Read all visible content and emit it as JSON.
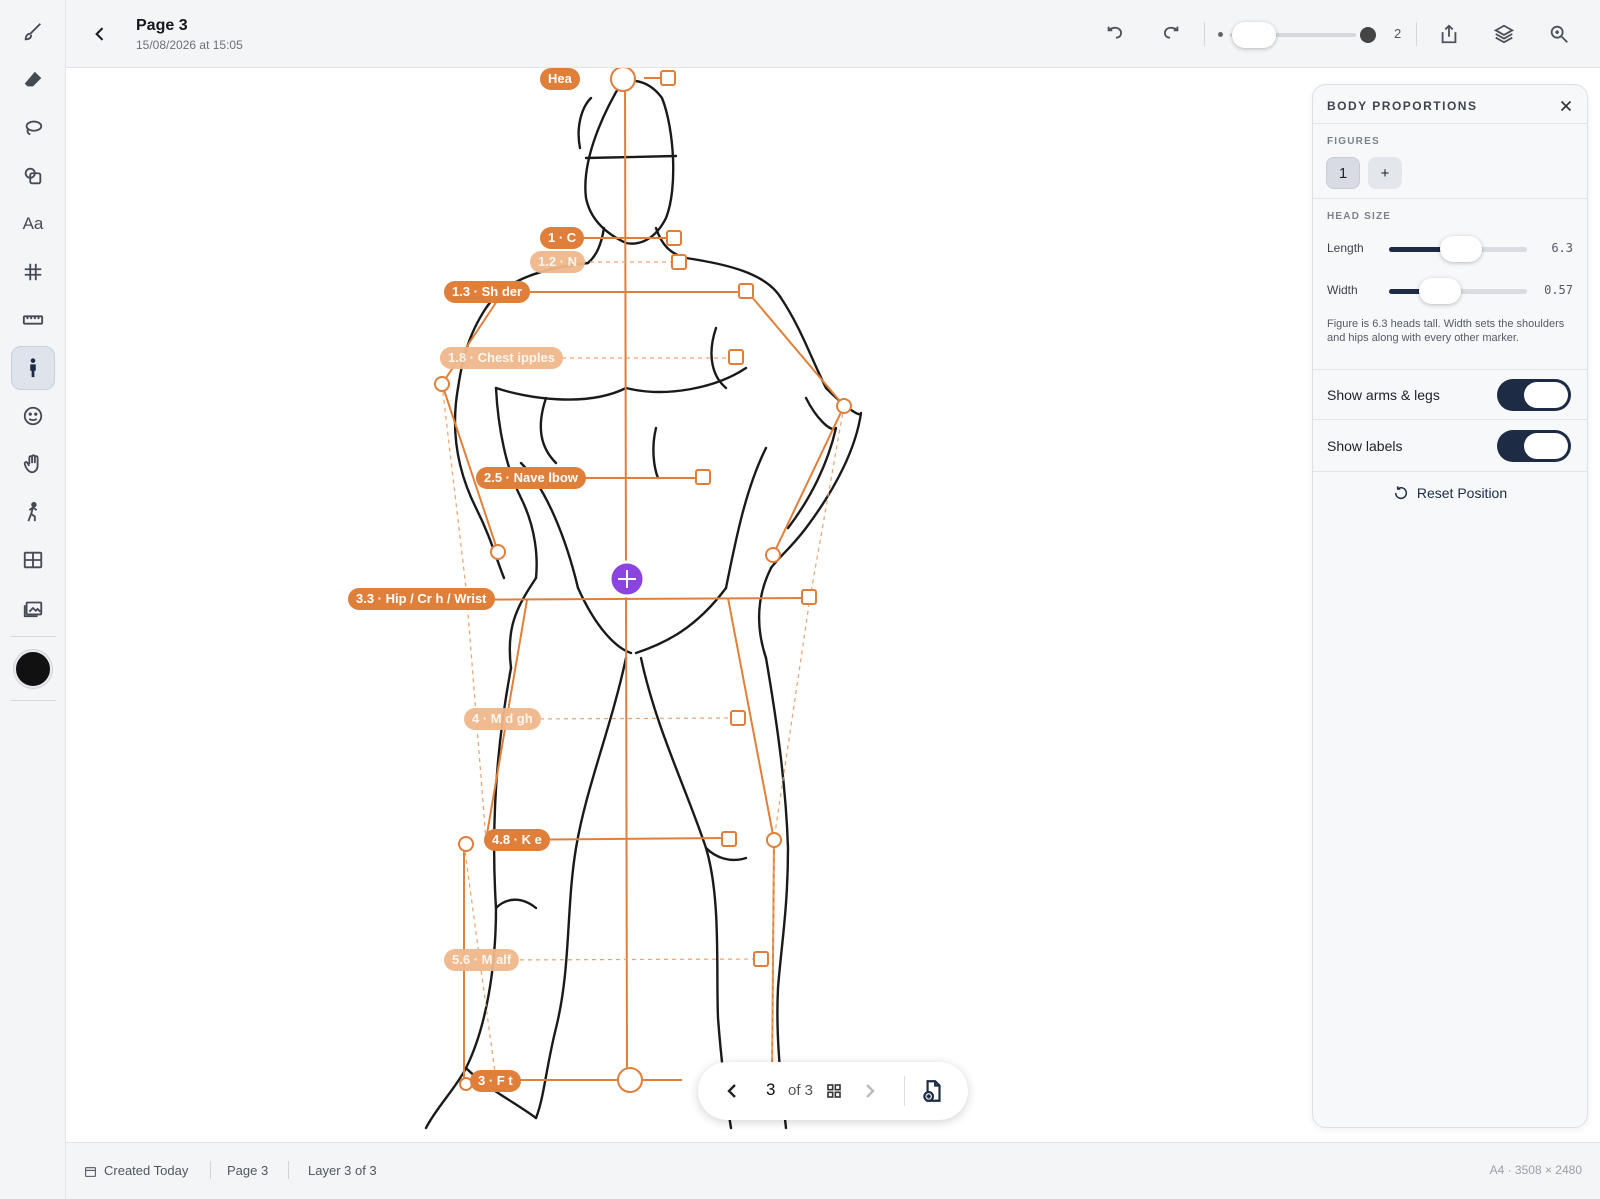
{
  "header": {
    "title": "Page 3",
    "date": "15/08/2026 at 15:05",
    "brush_size_value": "2"
  },
  "tools": [
    {
      "name": "brush-icon"
    },
    {
      "name": "eraser-icon"
    },
    {
      "name": "lasso-icon"
    },
    {
      "name": "shapes-icon"
    },
    {
      "name": "text-icon",
      "label": "Aa"
    },
    {
      "name": "grid-icon"
    },
    {
      "name": "ruler-icon"
    },
    {
      "name": "body-proportions-icon",
      "active": true
    },
    {
      "name": "face-icon"
    },
    {
      "name": "hand-icon"
    },
    {
      "name": "pose-icon"
    },
    {
      "name": "panels-icon"
    },
    {
      "name": "image-icon"
    }
  ],
  "current_color": "#111111",
  "accent_color": "#e07f3a",
  "labels": {
    "head": "Hea",
    "chin": "1 · C",
    "neck": "1.2 · N",
    "shoulder": "1.3 · Sh  der",
    "chest": "1.8 · Chest  ipples",
    "navel": "2.5 · Nave  lbow",
    "hip": "3.3 · Hip / Cr   h / Wrist",
    "midthigh": "4 · M  d  gh",
    "knee": "4.8 · K   e",
    "midcalf": "5.6 · M   alf",
    "foot": "3 · F   t"
  },
  "panel": {
    "title": "BODY PROPORTIONS",
    "figures_label": "FIGURES",
    "figure_count": "1",
    "add_label": "+",
    "head_size_label": "HEAD SIZE",
    "length_label": "Length",
    "length_value": "6.3",
    "length_fraction": 0.52,
    "width_label": "Width",
    "width_value": "0.57",
    "width_fraction": 0.37,
    "note": "Figure is 6.3 heads tall. Width sets the shoulders and hips along with every other marker.",
    "show_arms_label": "Show arms & legs",
    "show_arms_on": true,
    "show_labels_label": "Show labels",
    "show_labels_on": true,
    "reset_label": "Reset Position"
  },
  "pager": {
    "current": "3",
    "of_text": "of 3"
  },
  "status": {
    "created": "Created Today",
    "page": "Page  3",
    "layer": "Layer 3 of 3",
    "doc_size": "A4 · 3508 × 2480"
  }
}
